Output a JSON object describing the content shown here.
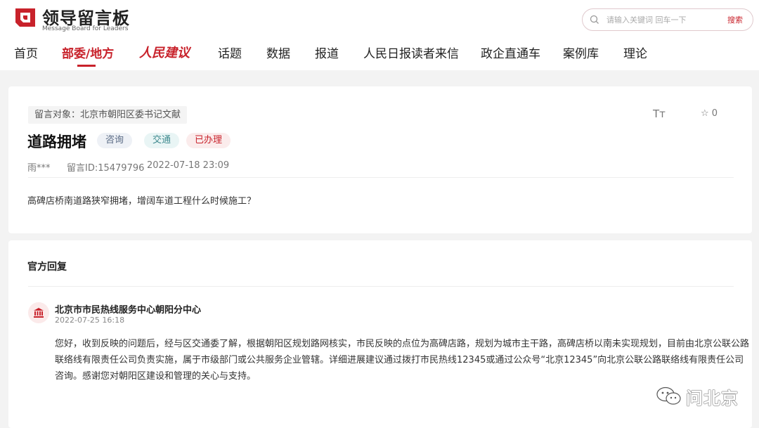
{
  "brand": {
    "name_cn": "领导留言板",
    "name_en": "Message Board for Leaders",
    "accent": "#c8222b"
  },
  "search": {
    "placeholder": "请输入关键词 回车一下",
    "button_label": "搜索"
  },
  "nav": {
    "items": [
      {
        "label": "首页"
      },
      {
        "label": "部委/地方"
      },
      {
        "label": "人民建议"
      },
      {
        "label": "话题"
      },
      {
        "label": "数据"
      },
      {
        "label": "报道"
      },
      {
        "label": "人民日报读者来信"
      },
      {
        "label": "政企直通车"
      },
      {
        "label": "案例库"
      },
      {
        "label": "理论"
      }
    ],
    "active": "部委/地方"
  },
  "message": {
    "target": "留言对象：北京市朝阳区委书记文献",
    "font_toggle": "Tт",
    "favorite_count": "0",
    "title": "道路拥堵",
    "tags": [
      "咨询",
      "交通",
      "已办理"
    ],
    "author": "雨***",
    "id_text": "留言ID:15479796",
    "time": "2022-07-18 23:09",
    "content": "高碑店桥南道路狭窄拥堵，增阔车道工程什么时候施工？"
  },
  "reply": {
    "section_title": "官方回复",
    "org_name": "北京市市民热线服务中心朝阳分中心",
    "time": "2022-07-25 16:18",
    "lines": [
      "您好，收到反映的问题后，经与区交通委了解，根据朝阳区规划路网核实，市民反映的点位为高碑店路，规划为城市主干路，高碑店桥以南未实现规划，目前由北京公联公路",
      "联络线有限责任公司负责实施，属于市级部门或公共服务企业管辖。详细进展建议通过拨打市民热线12345或通过公众号“北京12345”向北京公联公路联络线有限责任公司",
      "咨询。感谢您对朝阳区建设和管理的关心与支持。"
    ]
  },
  "watermark": {
    "text": "问北京"
  }
}
